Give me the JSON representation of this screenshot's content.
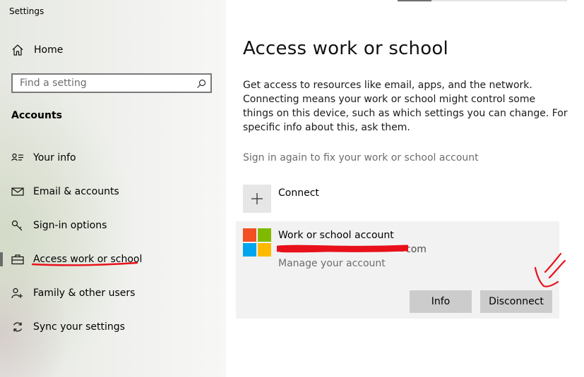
{
  "window": {
    "title": "Settings"
  },
  "sidebar": {
    "home_label": "Home",
    "search": {
      "placeholder": "Find a setting",
      "value": ""
    },
    "section_title": "Accounts",
    "items": [
      {
        "label": "Your info",
        "icon": "person-card-icon",
        "selected": false
      },
      {
        "label": "Email & accounts",
        "icon": "mail-icon",
        "selected": false
      },
      {
        "label": "Sign-in options",
        "icon": "key-icon",
        "selected": false
      },
      {
        "label": "Access work or school",
        "icon": "briefcase-icon",
        "selected": true
      },
      {
        "label": "Family & other users",
        "icon": "add-person-icon",
        "selected": false
      },
      {
        "label": "Sync your settings",
        "icon": "sync-icon",
        "selected": false
      }
    ]
  },
  "main": {
    "title": "Access work or school",
    "description": "Get access to resources like email, apps, and the network. Connecting means your work or school might control some things on this device, such as which settings you can change. For specific info about this, ask them.",
    "hint": "Sign in again to fix your work or school account",
    "connect_label": "Connect",
    "account": {
      "name": "Work or school account",
      "email_visible": "com",
      "manage_label": "Manage your account",
      "info_button": "Info",
      "disconnect_button": "Disconnect"
    }
  },
  "colors": {
    "annotation_red": "#e8101a",
    "ms_red": "#f25022",
    "ms_green": "#7fba00",
    "ms_blue": "#00a4ef",
    "ms_yellow": "#ffb900",
    "button_gray": "#cccccc",
    "card_gray": "#f2f2f2"
  }
}
